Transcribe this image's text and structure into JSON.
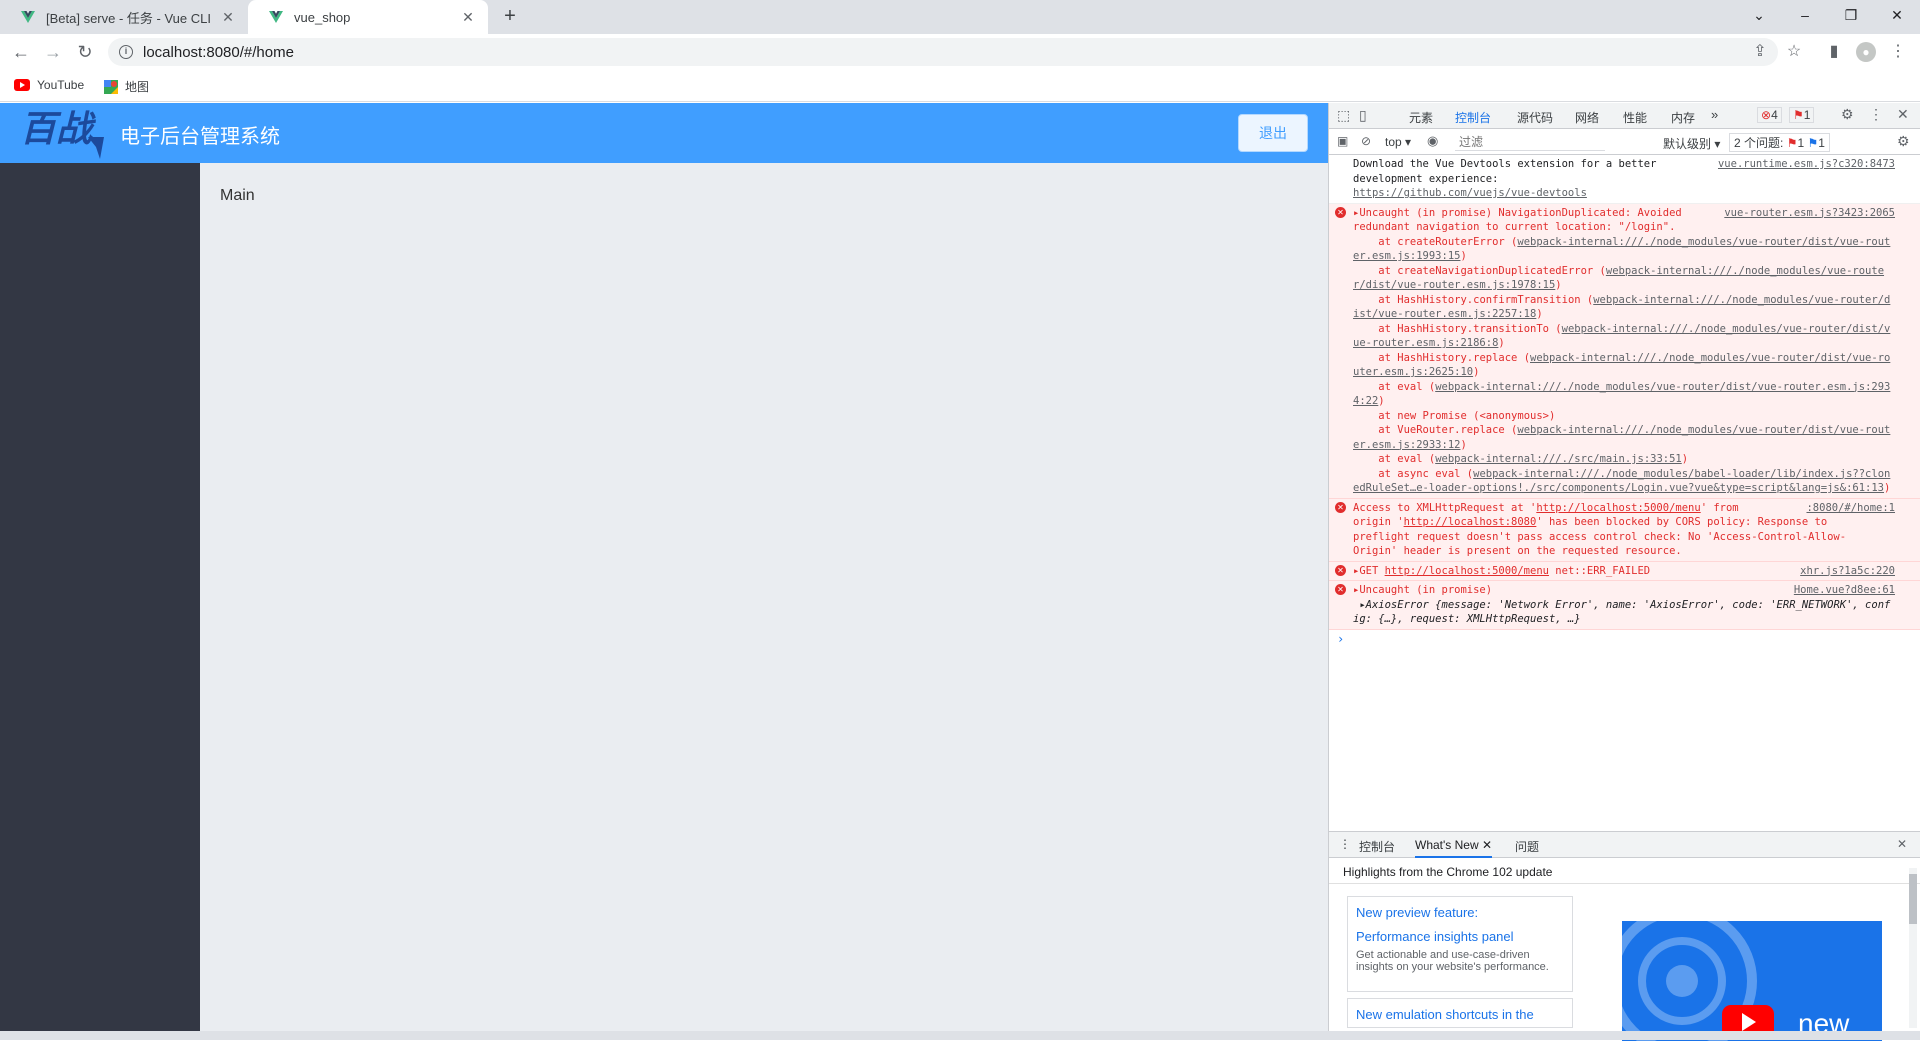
{
  "browser": {
    "tabs": [
      {
        "title": "[Beta] serve - 任务 - Vue CLI"
      },
      {
        "title": "vue_shop"
      }
    ],
    "new_tab": "+",
    "url": "localhost:8080/#/home",
    "bookmarks": [
      {
        "label": "YouTube"
      },
      {
        "label": "地图"
      }
    ]
  },
  "app": {
    "logo_text": "百战",
    "title": "电子后台管理系统",
    "logout_label": "退出",
    "main_text": "Main",
    "colors": {
      "header": "#409eff",
      "aside": "#333744",
      "main": "#eaedf1"
    }
  },
  "devtools": {
    "tabs": [
      "元素",
      "控制台",
      "源代码",
      "网络",
      "性能",
      "内存"
    ],
    "active_tab": "控制台",
    "more": "»",
    "error_count": "4",
    "issue_count": "1",
    "context": "top",
    "filter_placeholder": "过滤",
    "levels": "默认级别",
    "issues_label": "2 个问题:",
    "issues_err": "1",
    "issues_info": "1",
    "console": {
      "m1_text": "Download the Vue Devtools extension for a better\ndevelopment experience:",
      "m1_link": "https://github.com/vuejs/vue-devtools",
      "m1_src": "vue.runtime.esm.js?c320:8473",
      "m2_head": "▸Uncaught (in promise) NavigationDuplicated: Avoided\nredundant navigation to current location: \"/login\".",
      "m2_src": "vue-router.esm.js?3423:2065",
      "m2_stack": [
        {
          "pre": "    at createRouterError (",
          "link": "webpack-internal:///./node_modules/vue-router/dist/vue-router.esm.js:1993:15",
          "post": ")"
        },
        {
          "pre": "    at createNavigationDuplicatedError (",
          "link": "webpack-internal:///./node_modules/vue-router/dist/vue-router.esm.js:1978:15",
          "post": ")"
        },
        {
          "pre": "    at HashHistory.confirmTransition (",
          "link": "webpack-internal:///./node_modules/vue-router/dist/vue-router.esm.js:2257:18",
          "post": ")"
        },
        {
          "pre": "    at HashHistory.transitionTo (",
          "link": "webpack-internal:///./node_modules/vue-router/dist/vue-router.esm.js:2186:8",
          "post": ")"
        },
        {
          "pre": "    at HashHistory.replace (",
          "link": "webpack-internal:///./node_modules/vue-router/dist/vue-router.esm.js:2625:10",
          "post": ")"
        },
        {
          "pre": "    at eval (",
          "link": "webpack-internal:///./node_modules/vue-router/dist/vue-router.esm.js:2934:22",
          "post": ")"
        },
        {
          "pre": "    at new Promise (<anonymous>)",
          "link": "",
          "post": ""
        },
        {
          "pre": "    at VueRouter.replace (",
          "link": "webpack-internal:///./node_modules/vue-router/dist/vue-router.esm.js:2933:12",
          "post": ")"
        },
        {
          "pre": "    at eval (",
          "link": "webpack-internal:///./src/main.js:33:51",
          "post": ")"
        },
        {
          "pre": "    at async eval (",
          "link": "webpack-internal:///./node_modules/babel-loader/lib/index.js??clonedRuleSet…e-loader-options!./src/components/Login.vue?vue&type=script&lang=js&:61:13",
          "post": ")"
        }
      ],
      "m3_pre": "Access to XMLHttpRequest at '",
      "m3_link1": "http://localhost:5000/menu",
      "m3_mid": "' from\norigin '",
      "m3_link2": "http://localhost:8080",
      "m3_post": "' has been blocked by CORS policy: Response to\npreflight request doesn't pass access control check: No 'Access-Control-Allow-\nOrigin' header is present on the requested resource.",
      "m3_src": ":8080/#/home:1",
      "m4_pre": "▸GET ",
      "m4_link": "http://localhost:5000/menu",
      "m4_post": " net::ERR_FAILED",
      "m4_src": "xhr.js?1a5c:220",
      "m5_head": "▸Uncaught (in promise)",
      "m5_body": " ▸AxiosError {message: 'Network Error', name: 'AxiosError', code: 'ERR_NETWORK', config: {…}, request: XMLHttpRequest, …}",
      "m5_src": "Home.vue?d8ee:61",
      "prompt": "›"
    },
    "drawer": {
      "tabs": [
        "控制台",
        "What's New",
        "问题"
      ],
      "active": "What's New",
      "headline": "Highlights from the Chrome 102 update",
      "card1_title1": "New preview feature:",
      "card1_title2": "Performance insights panel",
      "card1_body": "Get actionable and use-case-driven insights on your website's performance.",
      "card2_title": "New emulation shortcuts in the",
      "promo_text": "new"
    }
  }
}
